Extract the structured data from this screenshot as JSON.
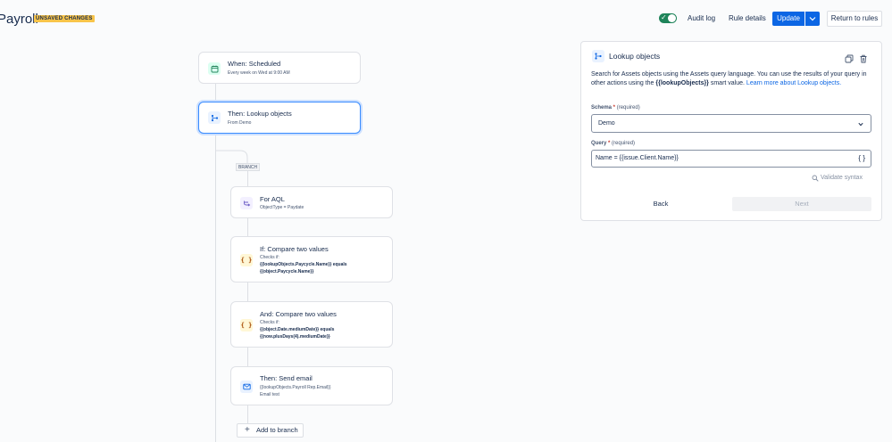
{
  "header": {
    "title": "Payroll",
    "unsaved_badge": "UNSAVED CHANGES",
    "audit_log": "Audit log",
    "rule_details": "Rule details",
    "update": "Update",
    "return_to_rules": "Return to rules",
    "toggle_on": true
  },
  "flow": {
    "trigger": {
      "title": "When: Scheduled",
      "subtitle": "Every week on Wed at 9:00 AM",
      "icon": "calendar-icon"
    },
    "lookup": {
      "title": "Then: Lookup objects",
      "subtitle": "From Demo",
      "icon": "branch-nodes-icon"
    },
    "branch_label": "BRANCH",
    "for_aql": {
      "title": "For AQL",
      "subtitle": "ObjectType = Paydate",
      "icon": "branch-loop-icon"
    },
    "if_compare": {
      "title": "If: Compare two values",
      "checks": "Checks if:",
      "line1": "{{lookupObjects.Paycycle.Name}} equals",
      "line2": "{{object.Paycycle.Name}}",
      "icon": "braces-icon"
    },
    "and_compare": {
      "title": "And: Compare two values",
      "checks": "Checks if:",
      "line1": "{{object.Date.mediumDate}} equals",
      "line2": "{{now.plusDays(4).mediumDate}}",
      "icon": "braces-icon"
    },
    "send_email": {
      "title": "Then: Send email",
      "line1": "{{lookupObjects.Payroll Rep.Email}}",
      "line2": "Email test",
      "icon": "envelope-icon"
    },
    "add_to_branch": "Add to branch"
  },
  "panel": {
    "title": "Lookup objects",
    "desc_part1": "Search for Assets objects using the Assets query language. You can use the results of your query in other actions using the ",
    "smart_value": "{{lookupObjects}}",
    "desc_part2": " smart value. ",
    "learn_more": "Learn more about Lookup objects",
    "desc_end": ".",
    "schema_label": "Schema",
    "schema_required": "(required)",
    "schema_value": "Demo",
    "query_label": "Query",
    "query_required": "(required)",
    "query_value": "Name = {{issue.Client.Name}}",
    "validate": "Validate syntax",
    "back": "Back",
    "next": "Next"
  },
  "colors": {
    "primary": "#0c66e4",
    "badge": "#f8c44a",
    "toggle": "#1f845a",
    "selected_border": "#388bff"
  }
}
